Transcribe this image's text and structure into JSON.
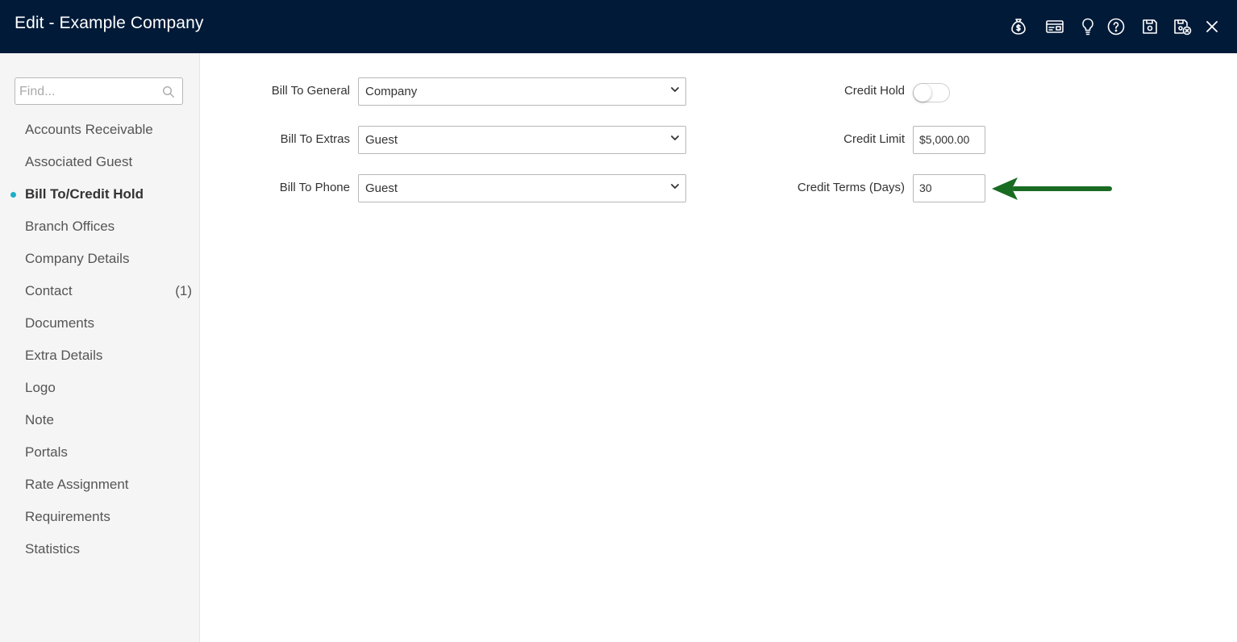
{
  "window": {
    "title": "Edit - Example Company",
    "toolbar_icons": [
      "money-bag-icon",
      "card-reader-icon",
      "lightbulb-icon",
      "help-icon",
      "save-icon",
      "save-close-icon",
      "close-icon"
    ]
  },
  "sidebar": {
    "search_placeholder": "Find...",
    "items": [
      {
        "label": "Accounts Receivable"
      },
      {
        "label": "Associated Guest"
      },
      {
        "label": "Bill To/Credit Hold",
        "active": true
      },
      {
        "label": "Branch Offices"
      },
      {
        "label": "Company Details"
      },
      {
        "label": "Contact",
        "count": "(1)"
      },
      {
        "label": "Documents"
      },
      {
        "label": "Extra Details"
      },
      {
        "label": "Logo"
      },
      {
        "label": "Note"
      },
      {
        "label": "Portals"
      },
      {
        "label": "Rate Assignment"
      },
      {
        "label": "Requirements"
      },
      {
        "label": "Statistics"
      }
    ]
  },
  "form": {
    "bill_to_general": {
      "label": "Bill To General",
      "value": "Company"
    },
    "bill_to_extras": {
      "label": "Bill To Extras",
      "value": "Guest"
    },
    "bill_to_phone": {
      "label": "Bill To Phone",
      "value": "Guest"
    },
    "credit_hold": {
      "label": "Credit Hold",
      "on": false
    },
    "credit_limit": {
      "label": "Credit Limit",
      "value": "$5,000.00"
    },
    "credit_terms": {
      "label": "Credit Terms (Days)",
      "value": "30"
    }
  },
  "colors": {
    "titlebar": "#001a38",
    "active_dot": "#1ab0c8",
    "annotation_arrow": "#1a6b22"
  }
}
